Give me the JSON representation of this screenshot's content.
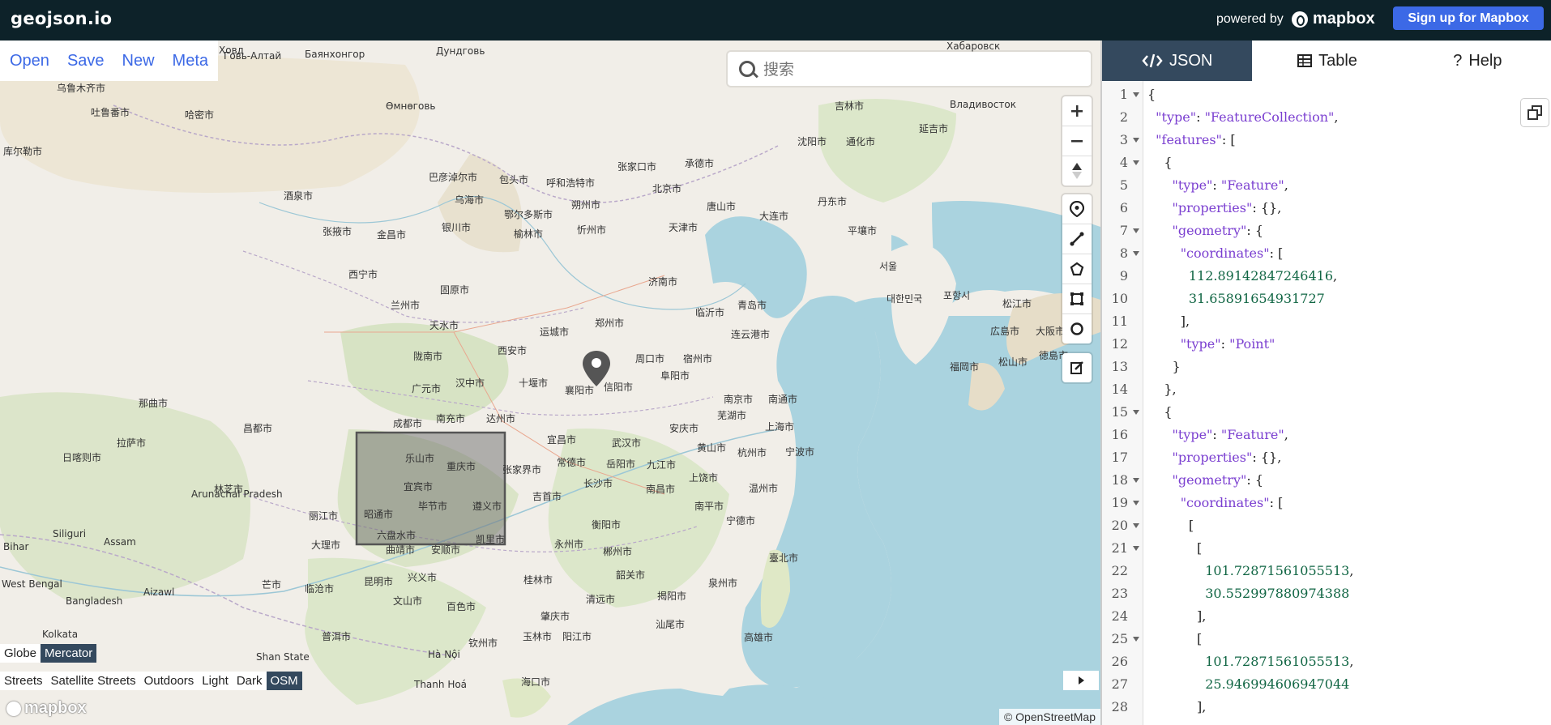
{
  "app": {
    "title": "geojson.io"
  },
  "header": {
    "powered_by": "powered by",
    "mapbox_logo": "mapbox",
    "signup_label": "Sign up for Mapbox"
  },
  "menu": {
    "items": [
      "Open",
      "Save",
      "New",
      "Meta"
    ]
  },
  "search": {
    "placeholder": "搜索",
    "icon": "search-icon"
  },
  "map_controls": {
    "zoom": [
      "zoom-in-icon",
      "zoom-out-icon",
      "compass-icon"
    ],
    "draw": [
      "marker-icon",
      "line-icon",
      "polygon-icon",
      "rectangle-icon",
      "circle-icon"
    ],
    "edit": [
      "edit-icon"
    ]
  },
  "projection": {
    "options": [
      "Globe",
      "Mercator"
    ],
    "selected": "Mercator"
  },
  "styles": {
    "options": [
      "Streets",
      "Satellite Streets",
      "Outdoors",
      "Light",
      "Dark",
      "OSM"
    ],
    "selected": "OSM"
  },
  "map": {
    "watermark": "mapbox",
    "attribution": "© OpenStreetMap",
    "labels": [
      {
        "text": "乌鲁木齐市"
      },
      {
        "text": "吐鲁番市"
      },
      {
        "text": "哈密市"
      },
      {
        "text": "库尔勒市"
      },
      {
        "text": "酒泉市"
      },
      {
        "text": "张掖市"
      },
      {
        "text": "金昌市"
      },
      {
        "text": "西宁市"
      },
      {
        "text": "兰州市"
      },
      {
        "text": "天水市"
      },
      {
        "text": "固原市"
      },
      {
        "text": "银川市"
      },
      {
        "text": "乌海市"
      },
      {
        "text": "包头市"
      },
      {
        "text": "呼和浩特市"
      },
      {
        "text": "巴彦淖尔市"
      },
      {
        "text": "鄂尔多斯市"
      },
      {
        "text": "榆林市"
      },
      {
        "text": "朔州市"
      },
      {
        "text": "忻州市"
      },
      {
        "text": "张家口市"
      },
      {
        "text": "承德市"
      },
      {
        "text": "北京市"
      },
      {
        "text": "天津市"
      },
      {
        "text": "唐山市"
      },
      {
        "text": "大连市"
      },
      {
        "text": "丹东市"
      },
      {
        "text": "沈阳市"
      },
      {
        "text": "通化市"
      },
      {
        "text": "延吉市"
      },
      {
        "text": "吉林市"
      },
      {
        "text": "平壤市"
      },
      {
        "text": "서울"
      },
      {
        "text": "대한민국"
      },
      {
        "text": "포항시"
      },
      {
        "text": "松江市"
      },
      {
        "text": "広島市"
      },
      {
        "text": "大阪市"
      },
      {
        "text": "福岡市"
      },
      {
        "text": "松山市"
      },
      {
        "text": "徳島市"
      },
      {
        "text": "济南市"
      },
      {
        "text": "青岛市"
      },
      {
        "text": "临沂市"
      },
      {
        "text": "连云港市"
      },
      {
        "text": "郑州市"
      },
      {
        "text": "西安市"
      },
      {
        "text": "运城市"
      },
      {
        "text": "十堰市"
      },
      {
        "text": "汉中市"
      },
      {
        "text": "陇南市"
      },
      {
        "text": "广元市"
      },
      {
        "text": "成都市"
      },
      {
        "text": "南充市"
      },
      {
        "text": "达州市"
      },
      {
        "text": "襄阳市"
      },
      {
        "text": "信阳市"
      },
      {
        "text": "周口市"
      },
      {
        "text": "阜阳市"
      },
      {
        "text": "宿州市"
      },
      {
        "text": "南京市"
      },
      {
        "text": "南通市"
      },
      {
        "text": "上海市"
      },
      {
        "text": "杭州市"
      },
      {
        "text": "宁波市"
      },
      {
        "text": "温州市"
      },
      {
        "text": "芜湖市"
      },
      {
        "text": "安庆市"
      },
      {
        "text": "黄山市"
      },
      {
        "text": "武汉市"
      },
      {
        "text": "宜昌市"
      },
      {
        "text": "常德市"
      },
      {
        "text": "岳阳市"
      },
      {
        "text": "九江市"
      },
      {
        "text": "南昌市"
      },
      {
        "text": "长沙市"
      },
      {
        "text": "吉首市"
      },
      {
        "text": "张家界市"
      },
      {
        "text": "上饶市"
      },
      {
        "text": "南平市"
      },
      {
        "text": "宁德市"
      },
      {
        "text": "衡阳市"
      },
      {
        "text": "永州市"
      },
      {
        "text": "郴州市"
      },
      {
        "text": "韶关市"
      },
      {
        "text": "桂林市"
      },
      {
        "text": "清远市"
      },
      {
        "text": "揭阳市"
      },
      {
        "text": "汕尾市"
      },
      {
        "text": "泉州市"
      },
      {
        "text": "臺北市"
      },
      {
        "text": "高雄市"
      },
      {
        "text": "肇庆市"
      },
      {
        "text": "玉林市"
      },
      {
        "text": "阳江市"
      },
      {
        "text": "海口市"
      },
      {
        "text": "钦州市"
      },
      {
        "text": "百色市"
      },
      {
        "text": "兴义市"
      },
      {
        "text": "文山市"
      },
      {
        "text": "昆明市"
      },
      {
        "text": "普洱市"
      },
      {
        "text": "临沧市"
      },
      {
        "text": "丽江市"
      },
      {
        "text": "大理市"
      },
      {
        "text": "芒市"
      },
      {
        "text": "曲靖市"
      },
      {
        "text": "安顺市"
      },
      {
        "text": "乐山市"
      },
      {
        "text": "重庆市"
      },
      {
        "text": "宜宾市"
      },
      {
        "text": "昭通市"
      },
      {
        "text": "毕节市"
      },
      {
        "text": "遵义市"
      },
      {
        "text": "六盘水市"
      },
      {
        "text": "凯里市"
      },
      {
        "text": "那曲市"
      },
      {
        "text": "昌都市"
      },
      {
        "text": "拉萨市"
      },
      {
        "text": "日喀则市"
      },
      {
        "text": "林芝市"
      },
      {
        "text": "Hà Nội"
      },
      {
        "text": "Thanh Hoá"
      },
      {
        "text": "Kolkata"
      },
      {
        "text": "Siliguri"
      },
      {
        "text": "Aizawl"
      },
      {
        "text": "Arunachal Pradesh"
      },
      {
        "text": "Assam"
      },
      {
        "text": "Bihar"
      },
      {
        "text": "West Bengal"
      },
      {
        "text": "Shan State"
      },
      {
        "text": "Bangladesh"
      },
      {
        "text": "Владивосток"
      },
      {
        "text": "Ховд"
      },
      {
        "text": "Баянхонгор"
      },
      {
        "text": "Өмнөговь"
      },
      {
        "text": "Дундговь"
      },
      {
        "text": "Говь-Алтай"
      },
      {
        "text": "Хабаровск"
      },
      {
        "text": "襄阳市"
      }
    ]
  },
  "panel": {
    "tabs": [
      {
        "label": "JSON",
        "icon": "code-icon"
      },
      {
        "label": "Table",
        "icon": "table-icon"
      },
      {
        "label": "Help",
        "icon": "help-icon"
      }
    ],
    "active_tab": "JSON",
    "copy_icon": "copy-icon",
    "code_lines": [
      "{",
      "  \"type\": \"FeatureCollection\",",
      "  \"features\": [",
      "    {",
      "      \"type\": \"Feature\",",
      "      \"properties\": {},",
      "      \"geometry\": {",
      "        \"coordinates\": [",
      "          112.89142847246416,",
      "          31.65891654931727",
      "        ],",
      "        \"type\": \"Point\"",
      "      }",
      "    },",
      "    {",
      "      \"type\": \"Feature\",",
      "      \"properties\": {},",
      "      \"geometry\": {",
      "        \"coordinates\": [",
      "          [",
      "            [",
      "              101.72871561055513,",
      "              30.552997880974388",
      "            ],",
      "            [",
      "              101.72871561055513,",
      "              25.946994606947044",
      "            ],"
    ],
    "fold_lines": [
      1,
      3,
      4,
      7,
      8,
      15,
      18,
      19,
      20,
      21,
      25
    ]
  }
}
